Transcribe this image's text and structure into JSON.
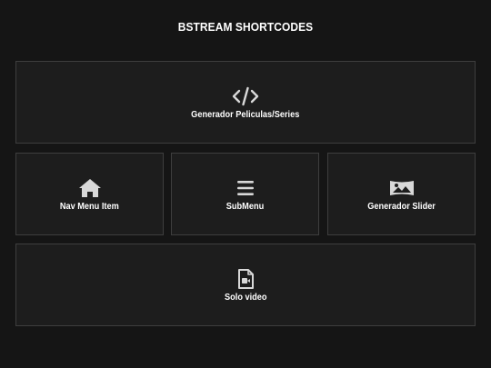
{
  "header": {
    "title": "BSTREAM SHORTCODES"
  },
  "cards": [
    {
      "label": "Generador Peliculas/Series",
      "icon": "code-icon"
    },
    {
      "label": "Nav Menu Item",
      "icon": "home-icon"
    },
    {
      "label": "SubMenu",
      "icon": "menu-icon"
    },
    {
      "label": "Generador Slider",
      "icon": "image-icon"
    },
    {
      "label": "Solo video",
      "icon": "video-file-icon"
    }
  ],
  "colors": {
    "background": "#151515",
    "card_background": "#1d1d1d",
    "card_border": "#3e3e3e",
    "icon": "#d8d8d8",
    "text": "#ffffff"
  }
}
